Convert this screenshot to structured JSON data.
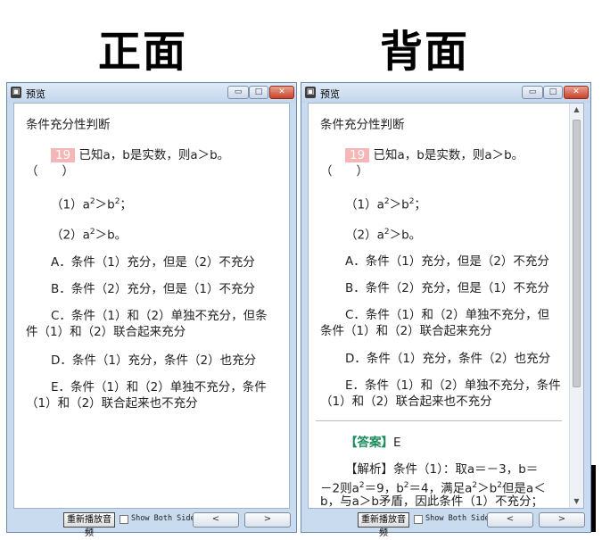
{
  "headings": {
    "front": "正面",
    "back": "背面"
  },
  "window": {
    "title": "预览",
    "app_icon": "app-icon",
    "minimize_glyph": "▭",
    "maximize_glyph": "□",
    "close_glyph": "✕"
  },
  "question": {
    "section_title": "条件充分性判断",
    "number": "19",
    "stem": "已知a，b是实数，则a＞b。",
    "blank": "（　　）",
    "cond1_prefix": "（1）a",
    "cond1_exp1": "2",
    "cond1_mid": "＞b",
    "cond1_exp2": "2",
    "cond1_suffix": "；",
    "cond2_prefix": "（2）a",
    "cond2_exp": "2",
    "cond2_suffix": "＞b。",
    "options": {
      "A": "A．条件（1）充分，但是（2）不充分",
      "B": "B．条件（2）充分，但是（1）不充分",
      "C_front_line1": "C．条件（1）和（2）单独不充分，但条",
      "C_front_line2": "件（1）和（2）联合起来充分",
      "C_back_line1": "C．条件（1）和（2）单独不充分，但",
      "C_back_line2": "条件（1）和（2）联合起来充分",
      "D": "D．条件（1）充分，条件（2）也充分",
      "E_line1": "E．条件（1）和（2）单独不充分，条件",
      "E_line2": "（1）和（2）联合起来也不充分"
    }
  },
  "answer": {
    "label": "【答案】",
    "value": "E",
    "analysis_label": "【解析】",
    "analysis_line1_a": "条件（1）：取a＝－3，b＝",
    "analysis_line2_a": "－2则a",
    "analysis_line2_exp1": "2",
    "analysis_line2_b": "＝9，b",
    "analysis_line2_exp2": "2",
    "analysis_line2_c": "＝4，满足a",
    "analysis_line2_exp3": "2",
    "analysis_line2_d": "＞b",
    "analysis_line2_exp4": "2",
    "analysis_line2_e": "但是a＜",
    "analysis_line3": "b，与a＞b矛盾，因此条件（1）不充分；"
  },
  "footer": {
    "replay_label": "重新播放音频",
    "show_both_label": "Show Both Sides",
    "prev_glyph": "<",
    "next_glyph": ">"
  },
  "scroll": {
    "up_glyph": "▲",
    "down_glyph": "▼"
  }
}
